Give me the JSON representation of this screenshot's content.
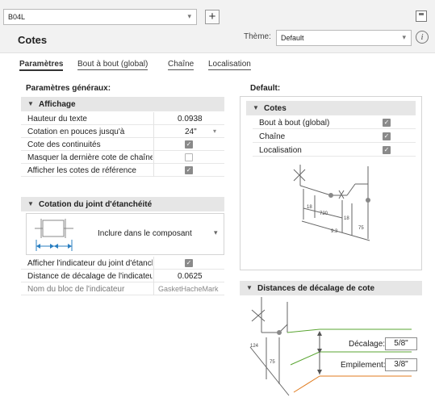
{
  "toolbar": {
    "combo_value": "B04L",
    "add_label": "+"
  },
  "header": {
    "title": "Cotes",
    "theme_label": "Thème:",
    "theme_value": "Default",
    "info_glyph": "i"
  },
  "tabs": [
    {
      "label": "Paramètres",
      "active": true
    },
    {
      "label": "Bout à bout (global)",
      "active": false
    },
    {
      "label": "Chaîne",
      "active": false
    },
    {
      "label": "Localisation",
      "active": false
    }
  ],
  "left": {
    "section_title": "Paramètres généraux:",
    "affichage": {
      "title": "Affichage",
      "rows": [
        {
          "label": "Hauteur du texte",
          "value": "0.0938"
        },
        {
          "label": "Cotation en pouces jusqu'à",
          "value": "24\""
        },
        {
          "label": "Cote des continuités",
          "checked": true
        },
        {
          "label": "Masquer la dernière cote de chaîne",
          "checked": false
        },
        {
          "label": "Afficher les cotes de référence",
          "checked": true
        }
      ]
    },
    "joint": {
      "title": "Cotation du joint d'étanchéité",
      "option": "Inclure dans le composant",
      "rows": [
        {
          "label": "Afficher l'indicateur du joint d'étanchéité",
          "checked": true
        },
        {
          "label": "Distance de décalage de l'indicateur",
          "value": "0.0625"
        },
        {
          "label": "Nom du bloc de l'indicateur",
          "value": "GasketHacheMark"
        }
      ]
    }
  },
  "right": {
    "section_title": "Default:",
    "cotes": {
      "title": "Cotes",
      "rows": [
        {
          "label": "Bout à bout (global)",
          "checked": true
        },
        {
          "label": "Chaîne",
          "checked": true
        },
        {
          "label": "Localisation",
          "checked": true
        }
      ]
    },
    "distances": {
      "title": "Distances de décalage de cote",
      "decalage_label": "Décalage:",
      "decalage_value": "5/8\"",
      "empilement_label": "Empilement:",
      "empilement_value": "3/8\""
    }
  },
  "illustrations": {
    "top_dims": [
      "18",
      "720",
      "18",
      "9.3",
      "75"
    ],
    "bottom_dims": [
      "124",
      "75"
    ]
  },
  "colors": {
    "accent_arrow": "#2a7fc1",
    "green_line": "#5aa532",
    "orange_line": "#e07b1e"
  }
}
